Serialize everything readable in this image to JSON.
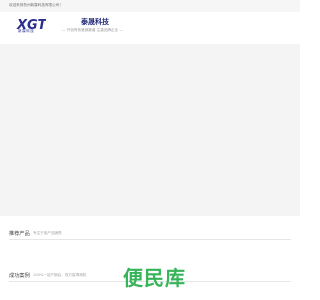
{
  "topbar": {
    "welcome_text": "欢迎来到杭州新霖科技有限公司！"
  },
  "header": {
    "logo_text": "XGT",
    "logo_caption": "新霖科技",
    "brand_name": "泰晟科技",
    "slogan": "— 开创有效营销渠道 注重品牌企业 —"
  },
  "sections": {
    "products": {
      "title": "推荐产品",
      "subtitle": "专注于各产品销售"
    },
    "cases": {
      "title": "成功案例",
      "subtitle": "100%一站产销后，双方赢得商机"
    }
  },
  "watermark": {
    "text": "便民库",
    "color": "#37b35a"
  },
  "colors": {
    "brand": "#222a78",
    "banner": "#f4f4f4"
  }
}
